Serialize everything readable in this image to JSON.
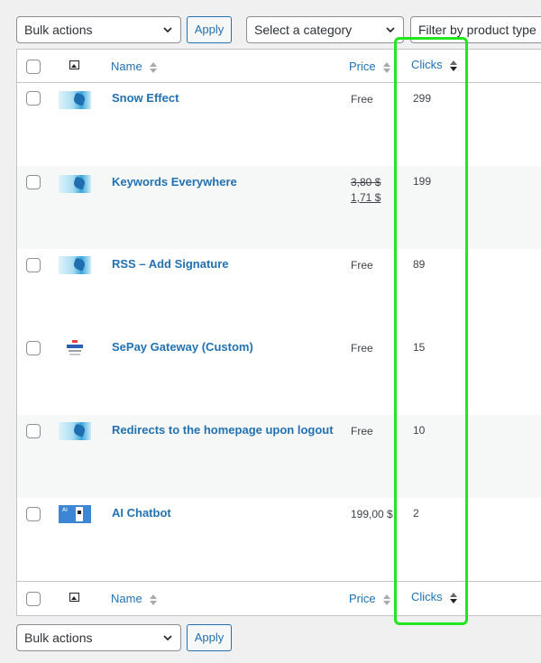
{
  "topbar": {
    "bulk_actions": "Bulk actions",
    "apply": "Apply",
    "category": "Select a category",
    "product_type": "Filter by product type"
  },
  "columns": {
    "name": "Name",
    "price": "Price",
    "clicks": "Clicks"
  },
  "rows": [
    {
      "thumb": "sky-icon",
      "name": "Snow Effect",
      "price": "Free",
      "price_old": "",
      "price_new": "",
      "clicks": "299"
    },
    {
      "thumb": "sky-icon",
      "name": "Keywords Everywhere",
      "price": "",
      "price_old": "3,80 $",
      "price_new": "1,71 $",
      "clicks": "199"
    },
    {
      "thumb": "sky-icon",
      "name": "RSS – Add Signature",
      "price": "Free",
      "price_old": "",
      "price_new": "",
      "clicks": "89"
    },
    {
      "thumb": "sepay-icon",
      "name": "SePay Gateway (Custom)",
      "price": "Free",
      "price_old": "",
      "price_new": "",
      "clicks": "15"
    },
    {
      "thumb": "sky-icon",
      "name": "Redirects to the homepage upon logout",
      "price": "Free",
      "price_old": "",
      "price_new": "",
      "clicks": "10"
    },
    {
      "thumb": "ai-icon",
      "thumb_text": "AI",
      "name": "AI Chatbot",
      "price": "199,00 $",
      "price_old": "",
      "price_new": "",
      "clicks": "2"
    }
  ],
  "bottombar": {
    "bulk_actions": "Bulk actions",
    "apply": "Apply"
  },
  "colors": {
    "link": "#2271b1",
    "highlight": "#22e61e",
    "alt_row": "#f6f7f7"
  }
}
